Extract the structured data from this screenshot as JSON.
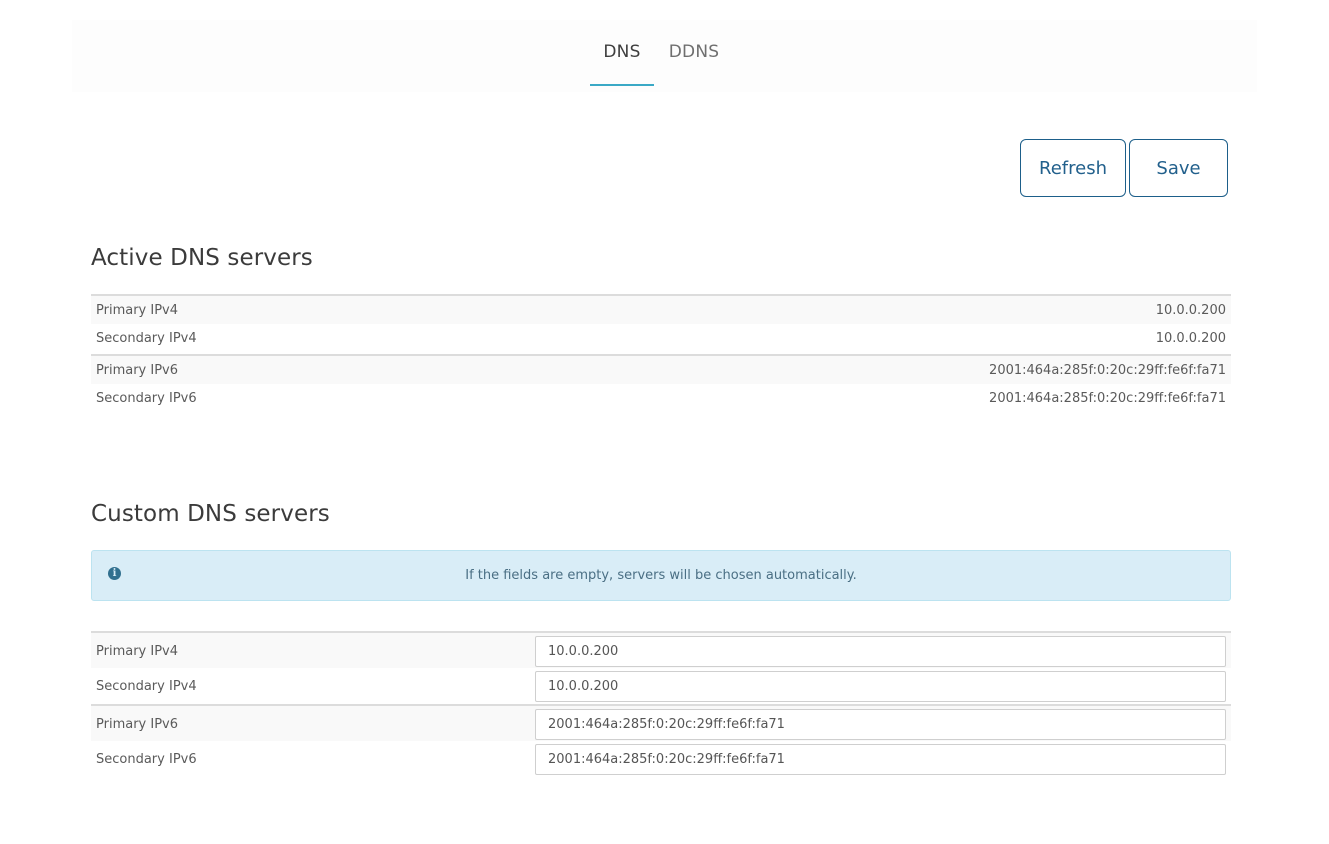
{
  "tabs": [
    {
      "label": "DNS",
      "active": true
    },
    {
      "label": "DDNS",
      "active": false
    }
  ],
  "toolbar": {
    "refresh_label": "Refresh",
    "save_label": "Save"
  },
  "active": {
    "title": "Active DNS servers",
    "rows": [
      {
        "label": "Primary IPv4",
        "value": "10.0.0.200"
      },
      {
        "label": "Secondary IPv4",
        "value": "10.0.0.200"
      },
      {
        "label": "Primary IPv6",
        "value": "2001:464a:285f:0:20c:29ff:fe6f:fa71"
      },
      {
        "label": "Secondary IPv6",
        "value": "2001:464a:285f:0:20c:29ff:fe6f:fa71"
      }
    ]
  },
  "custom": {
    "title": "Custom DNS servers",
    "info": "If the fields are empty, servers will be chosen automatically.",
    "info_icon": "info-circle-icon",
    "rows": [
      {
        "label": "Primary IPv4",
        "value": "10.0.0.200"
      },
      {
        "label": "Secondary IPv4",
        "value": "10.0.0.200"
      },
      {
        "label": "Primary IPv6",
        "value": "2001:464a:285f:0:20c:29ff:fe6f:fa71"
      },
      {
        "label": "Secondary IPv6",
        "value": "2001:464a:285f:0:20c:29ff:fe6f:fa71"
      }
    ]
  },
  "colors": {
    "accent": "#3aa9c6",
    "button_border": "#1d5f8a",
    "info_bg": "#d9edf7"
  }
}
